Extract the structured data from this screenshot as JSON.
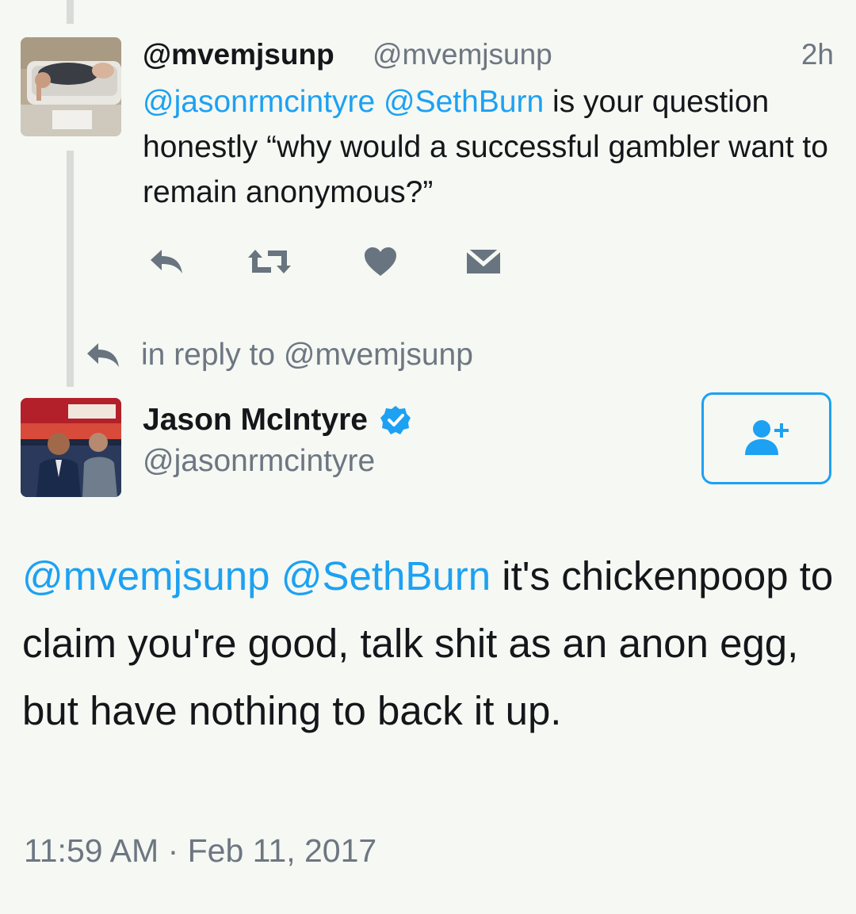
{
  "parent_tweet": {
    "display_name": "@mvemjsunp",
    "handle": "@mvemjsunp",
    "time": "2h",
    "mention_1": "@jasonrmcintyre",
    "mention_2": "@SethBurn",
    "text": " is your question honestly “why would a successful gambler want to remain anonymous?”",
    "avatar_icon": "person-in-bathtub-photo"
  },
  "actions": {
    "reply_icon": "reply-icon",
    "retweet_icon": "retweet-icon",
    "like_icon": "heart-icon",
    "dm_icon": "envelope-icon"
  },
  "reply_context": {
    "text": "in reply to @mvemjsunp"
  },
  "main_tweet": {
    "display_name": "Jason McIntyre",
    "handle": "@jasonrmcintyre",
    "verified": true,
    "mention_1": "@mvemjsunp",
    "mention_2": "@SethBurn",
    "text": " it's chickenpoop to claim you're good, talk shit as an anon egg, but have nothing to back it up.",
    "timestamp": "11:59 AM · Feb 11, 2017",
    "avatar_icon": "tv-studio-photo"
  },
  "colors": {
    "background": "#f5f8f3",
    "link": "#1da1f2",
    "muted": "#6d7681",
    "text": "#14171a",
    "icon": "#68747f"
  }
}
